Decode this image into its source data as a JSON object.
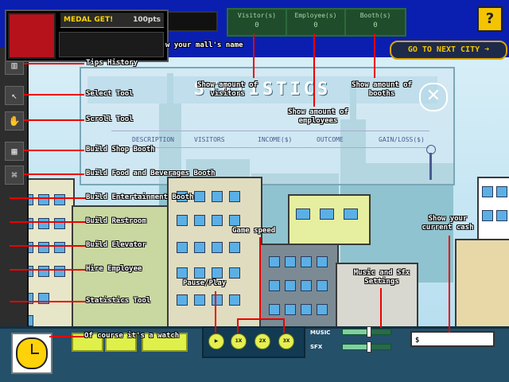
{
  "medal": {
    "title": "MEDAL GET!",
    "points": "100pts"
  },
  "top_stats": [
    {
      "label": "Visitor(s)",
      "value": "0"
    },
    {
      "label": "Employee(s)",
      "value": "0"
    },
    {
      "label": "Booth(s)",
      "value": "0"
    }
  ],
  "help_label": "?",
  "next_city_label": "GO TO NEXT CITY",
  "next_city_arrow": "➜",
  "statistics": {
    "title": "STATISTICS",
    "close_label": "✕",
    "columns": [
      "DESCRIPTION",
      "VISITORS",
      "INCOME($)",
      "OUTCOME",
      "GAIN/LOSS($)"
    ]
  },
  "speed_buttons": [
    "▶",
    "1X",
    "2X",
    "3X"
  ],
  "music_label": "MUSIC",
  "sfx_label": "SFX",
  "volume": {
    "music": 0.55,
    "sfx": 0.55
  },
  "cash_value": "$",
  "annotations": {
    "mall_name": "w your mall's name",
    "tips_history": "Tips History",
    "select_tool": "Select Tool",
    "scroll_tool": "Scroll Tool",
    "build_shop": "Build Shop Booth",
    "build_food": "Build Food and Beverages Booth",
    "build_entertainment": "Build Entertainment Booth",
    "build_restroom": "Build Restroom",
    "build_elevator": "Build Elevator",
    "hire_employee": "Hire Employee",
    "statistics_tool": "Statistics Tool",
    "watch": "Of course it's a watch",
    "visitors_amount": "Show amount of visitors",
    "employees_amount": "Show amount of employees",
    "booths_amount": "Show amount of booths",
    "game_speed": "Game speed",
    "pause_play": "Pause/Play",
    "music_sfx": "Music and Sfx Settings",
    "current_cash": "Show your current cash"
  },
  "colors": {
    "accent": "#f5c400",
    "annotation_line": "#ee0000",
    "sky": "#d7eef7"
  }
}
